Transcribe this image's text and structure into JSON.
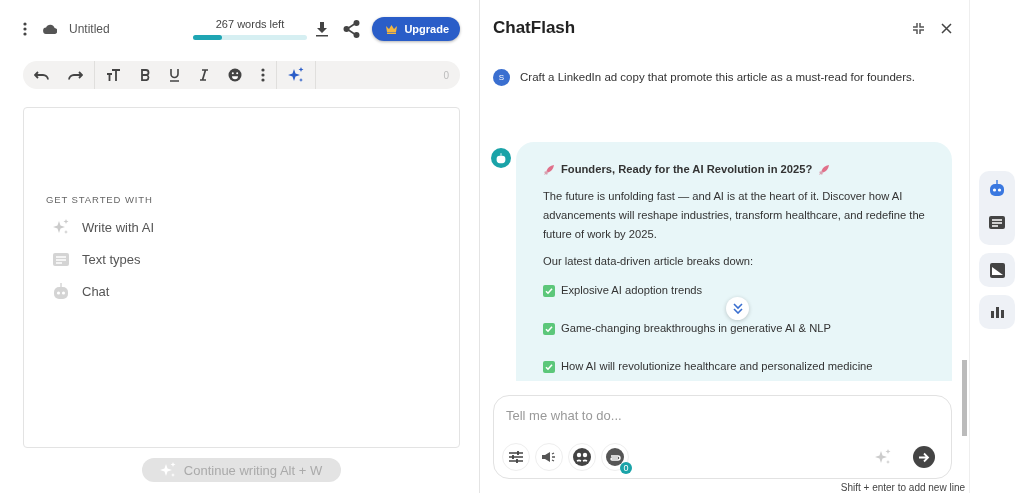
{
  "editor": {
    "title": "Untitled",
    "words_left": "267 words left",
    "word_bar": {
      "level": 0.25
    },
    "upgrade": "Upgrade",
    "char_count": "0",
    "get_started": "GET STARTED WITH",
    "options": [
      {
        "kind": "ai",
        "label": "Write with AI"
      },
      {
        "kind": "types",
        "label": "Text types"
      },
      {
        "kind": "chat",
        "label": "Chat"
      }
    ],
    "continue_button": "Continue writing Alt + W"
  },
  "chat": {
    "title": "ChatFlash",
    "user_message": {
      "avatar": "S",
      "text": "Craft a LinkedIn ad copy that promote this article as a must-read for founders."
    },
    "reply": {
      "heading": "Founders, Ready for the AI Revolution in 2025?",
      "paragraphs": [
        "The future is unfolding fast — and AI is at the heart of it. Discover how AI advancements will reshape industries, transform healthcare, and redefine the future of work by 2025.",
        "Our latest data-driven article breaks down:"
      ],
      "points": [
        "Explosive AI adoption trends",
        "Game-changing breakthroughs in generative AI & NLP",
        "How AI will revolutionize healthcare and personalized medicine"
      ]
    },
    "input": {
      "placeholder": "Tell me what to do...",
      "attachment_count": "0"
    },
    "hint": "Shift + enter to add new line"
  },
  "rail": [
    {
      "kind": "chat",
      "selected": true
    },
    {
      "kind": "templates",
      "selected": false
    },
    {
      "kind": "image",
      "selected": false
    },
    {
      "kind": "analytics",
      "selected": false
    }
  ]
}
